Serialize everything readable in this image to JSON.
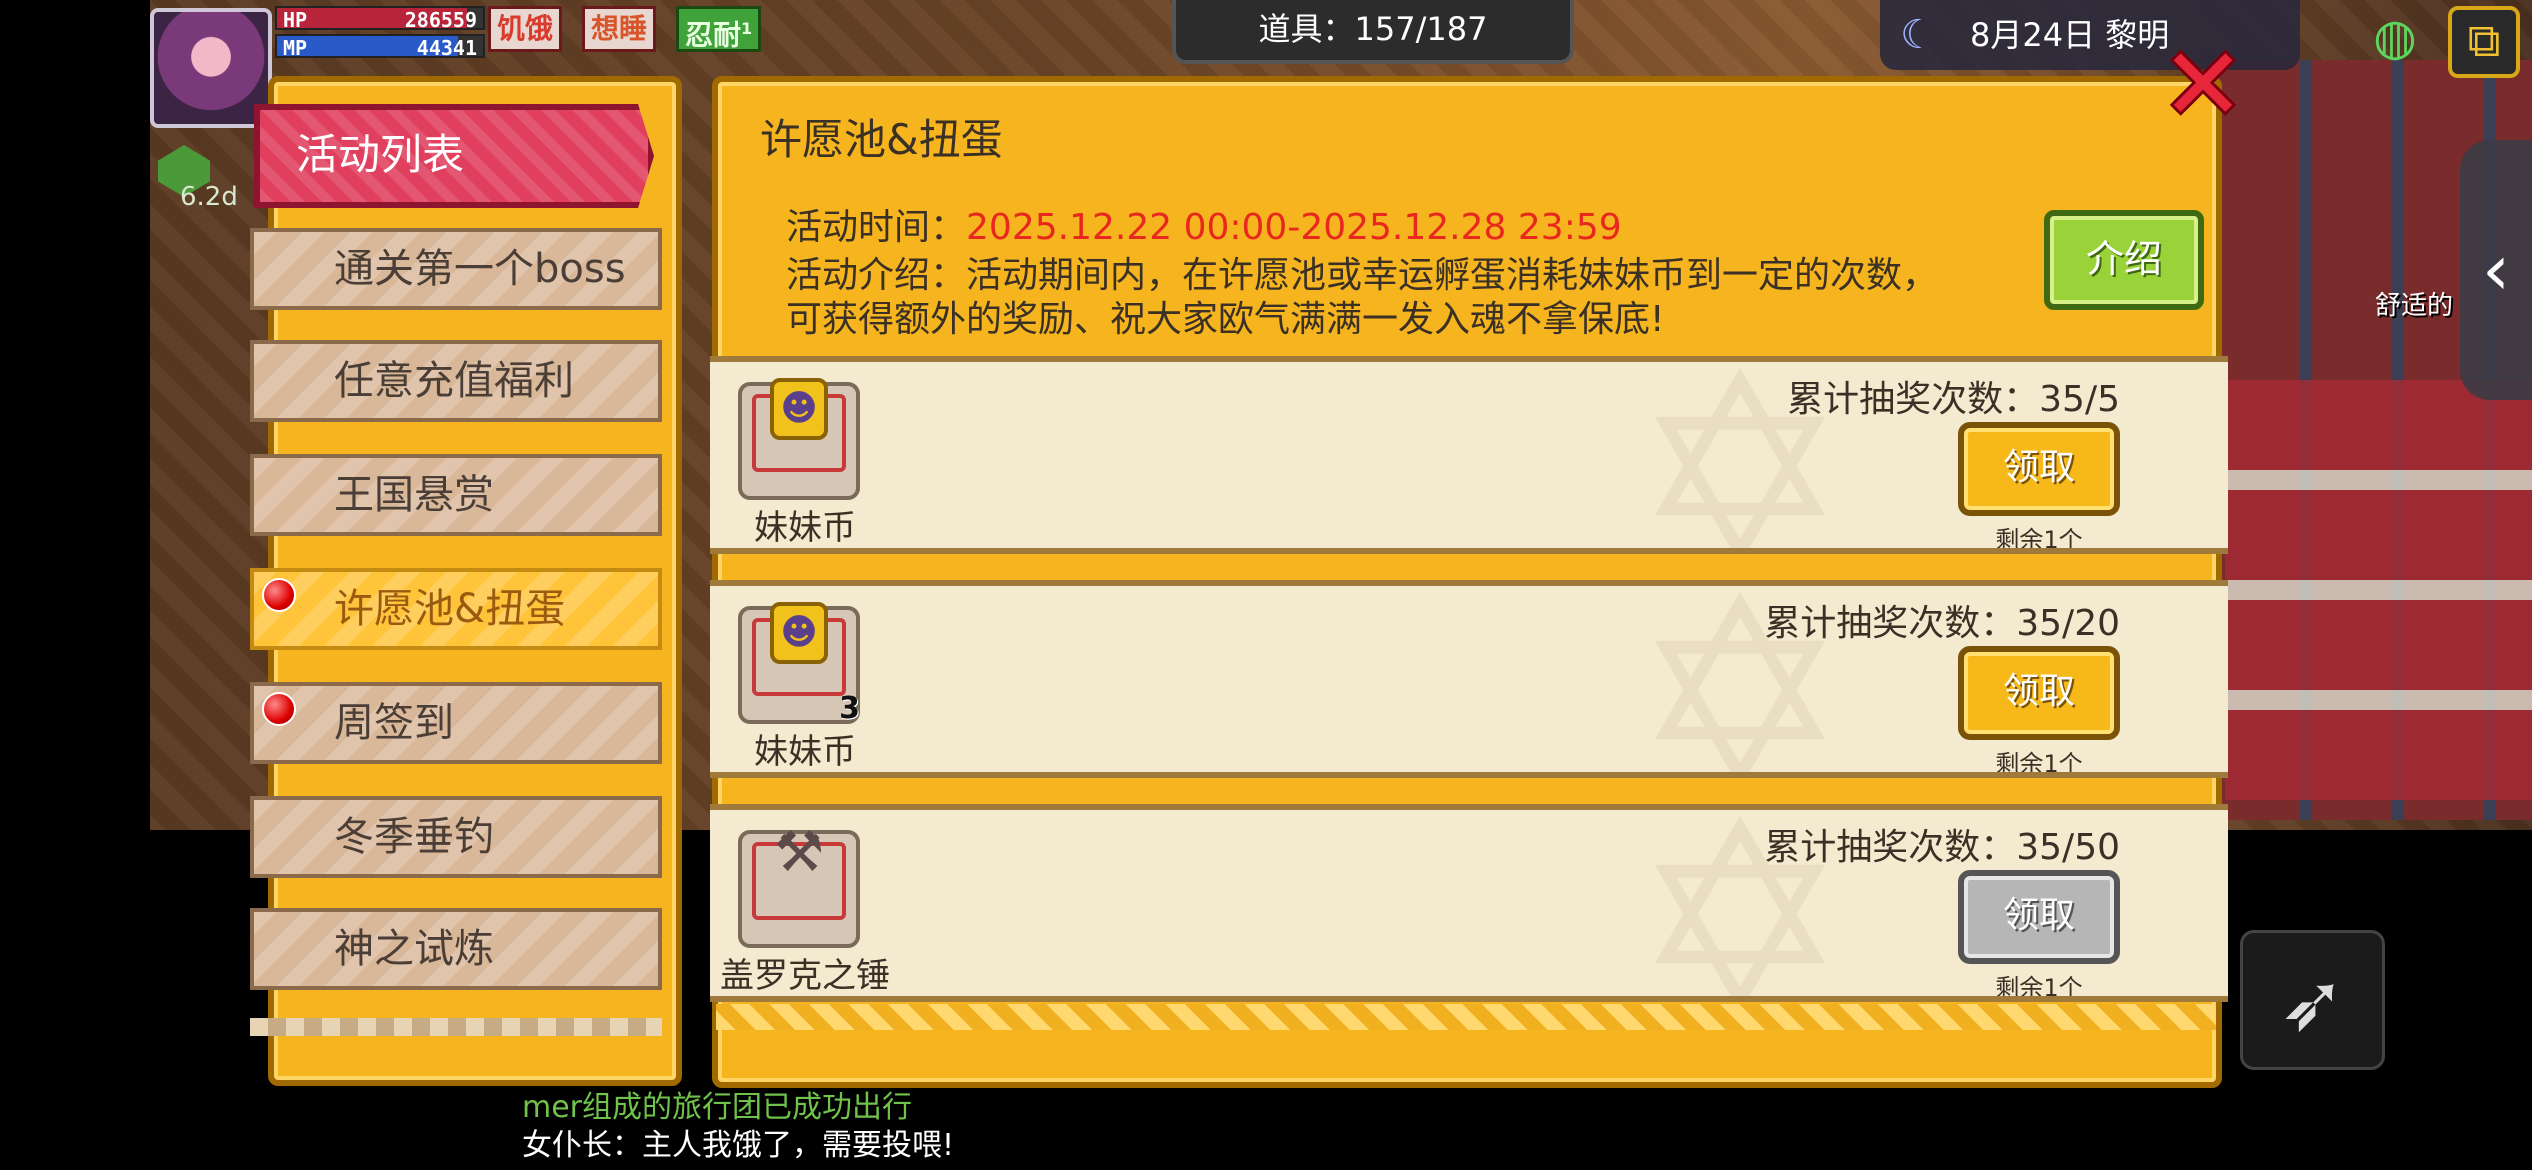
{
  "hud": {
    "hp_label": "HP",
    "hp_value": "286559",
    "mp_label": "MP",
    "mp_value": "44341",
    "status": [
      {
        "label": "饥饿",
        "color": "#d83b2b"
      },
      {
        "label": "想睡",
        "color": "#d8552b"
      },
      {
        "label": "忍耐",
        "color": "#3fa23a"
      }
    ],
    "status_badge": "1",
    "exp_text": "6.2d",
    "items_text": "道具：157/187",
    "date_text": "8月24日  黎明",
    "side_label": "舒适的"
  },
  "chat": {
    "line1": "mer组成的旅行团已成功出行",
    "line2": "女仆长：主人我饿了，需要投喂!"
  },
  "sidebar": {
    "title": "活动列表",
    "items": [
      {
        "label": "通关第一个boss",
        "dot": false,
        "active": false
      },
      {
        "label": "任意充值福利",
        "dot": false,
        "active": false
      },
      {
        "label": "王国悬赏",
        "dot": false,
        "active": false
      },
      {
        "label": "许愿池&扭蛋",
        "dot": true,
        "active": true
      },
      {
        "label": "周签到",
        "dot": true,
        "active": false
      },
      {
        "label": "冬季垂钓",
        "dot": false,
        "active": false
      },
      {
        "label": "神之试炼",
        "dot": false,
        "active": false
      }
    ]
  },
  "event": {
    "title": "许愿池&扭蛋",
    "time_label": "活动时间：",
    "time_value": "2025.12.22 00:00-2025.12.28 23:59",
    "desc_line1": "活动介绍：活动期间内，在许愿池或幸运孵蛋消耗妹妹币到一定的次数，",
    "desc_line2": "可获得额外的奖励、祝大家欧气满满一发入魂不拿保底!",
    "intro_button": "介绍"
  },
  "rewards": [
    {
      "item": "妹妹币",
      "quantity": "",
      "icon": "coin-icon",
      "count": "累计抽奖次数：35/5",
      "button": "领取",
      "enabled": true,
      "remain": "剩余1个"
    },
    {
      "item": "妹妹币",
      "quantity": "3",
      "icon": "coin-icon",
      "count": "累计抽奖次数：35/20",
      "button": "领取",
      "enabled": true,
      "remain": "剩余1个"
    },
    {
      "item": "盖罗克之锤",
      "quantity": "",
      "icon": "hammer-icon",
      "count": "累计抽奖次数：35/50",
      "button": "领取",
      "enabled": false,
      "remain": "剩余1个"
    }
  ],
  "colors": {
    "panel": "#f6b51e",
    "title_red": "#e0405e",
    "time_red": "#e8281e",
    "intro_green": "#9ad23a"
  }
}
